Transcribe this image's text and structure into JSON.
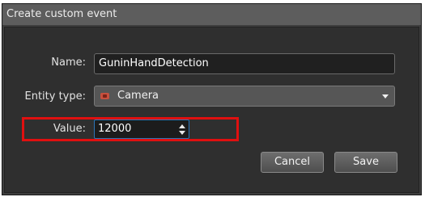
{
  "dialog": {
    "title": "Create custom event"
  },
  "form": {
    "name_label": "Name:",
    "name_value": "GuninHandDetection",
    "entity_type_label": "Entity type:",
    "entity_type_value": "Camera",
    "entity_type_icon": "camera-icon",
    "value_label": "Value:",
    "value_value": "12000"
  },
  "buttons": {
    "cancel_label": "Cancel",
    "save_label": "Save"
  },
  "colors": {
    "highlight": "#e01010",
    "focus_border": "#2d75b8"
  }
}
